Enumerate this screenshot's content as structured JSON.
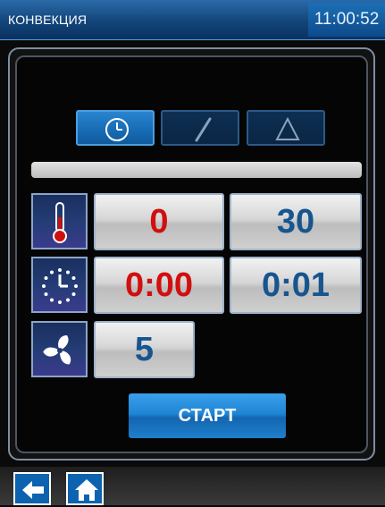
{
  "header": {
    "title": "КОНВЕКЦИЯ",
    "clock": "11:00:52"
  },
  "mode_tabs": [
    {
      "icon": "clock-icon",
      "active": true
    },
    {
      "icon": "probe-icon",
      "active": false
    },
    {
      "icon": "triangle-icon",
      "active": false
    }
  ],
  "progress": {
    "fraction": 0.0
  },
  "rows": {
    "temperature": {
      "icon": "thermometer-icon",
      "current": "0",
      "target": "30"
    },
    "time": {
      "icon": "timer-icon",
      "current": "0:00",
      "target": "0:01"
    },
    "fan": {
      "icon": "fan-icon",
      "value": "5"
    }
  },
  "start_label": "СТАРТ",
  "footer": {
    "back_icon": "arrow-left-icon",
    "home_icon": "home-icon"
  },
  "colors": {
    "accent": "#1f86d6",
    "current_value": "#d10f0f",
    "target_value": "#17558f"
  }
}
